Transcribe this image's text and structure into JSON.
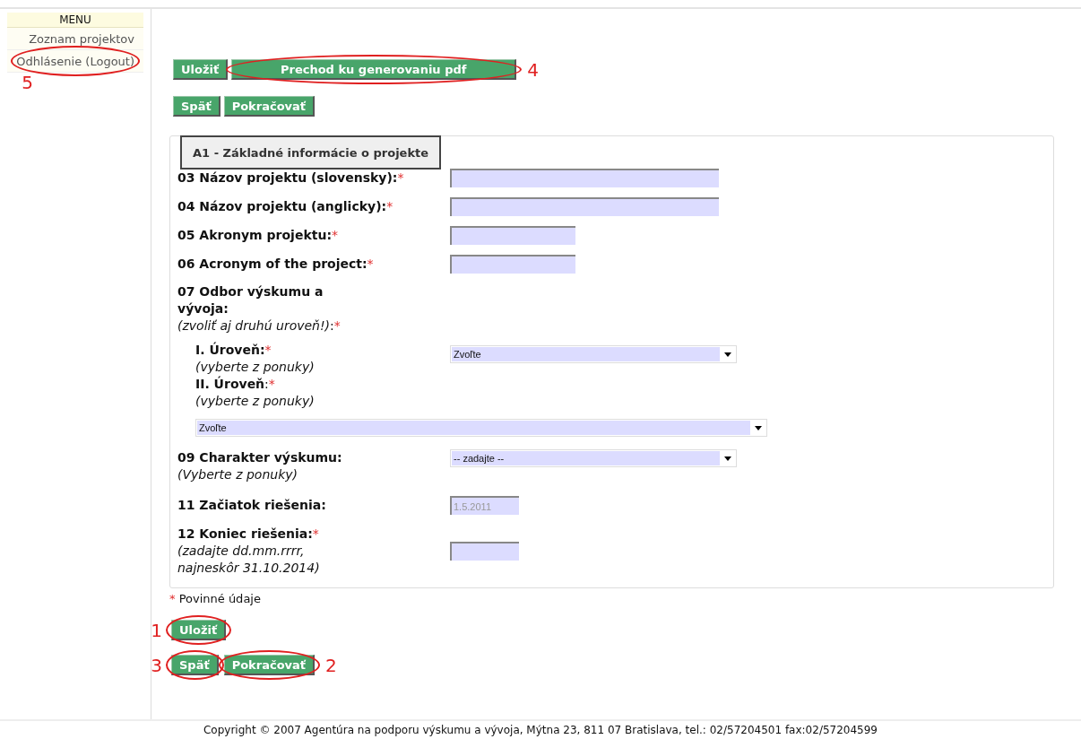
{
  "sidebar": {
    "title": "MENU",
    "items": [
      {
        "label": "Zoznam projektov"
      },
      {
        "label": "Odhlásenie (Logout)",
        "marker": "5"
      }
    ]
  },
  "top_actions": [
    {
      "label": "Uložiť"
    },
    {
      "label": "Prechod ku generovaniu pdf",
      "marker": "4"
    }
  ],
  "top_nav": [
    {
      "label": "Späť"
    },
    {
      "label": "Pokračovať"
    }
  ],
  "form": {
    "legend": "A1 - Základné informácie o projekte",
    "required_mark": "*",
    "fields": [
      {
        "kind": "long_text",
        "label": "03 Názov projektu (slovensky):",
        "required": true
      },
      {
        "kind": "long_text",
        "label": "04 Názov projektu (anglicky):",
        "required": true
      },
      {
        "kind": "short_text",
        "label": "05 Akronym projektu:",
        "required": true
      },
      {
        "kind": "short_text",
        "label": "06 Acronym of the project:",
        "required": true
      },
      {
        "kind": "group",
        "label": "07 Odbor výskumu a vývoja:",
        "hint": "*(zvoliť aj druhú uroveň!)*:",
        "required": true,
        "children": [
          {
            "kind": "inline_select",
            "label": "I. Úroveň:",
            "hint": "(vyberte z ponuky)",
            "required": true,
            "value": "Zvoľte"
          },
          {
            "kind": "wide_select",
            "label": "**II. Úroveň**:",
            "hint": "(vyberte z ponuky)",
            "required": true,
            "value": "Zvoľte"
          }
        ]
      },
      {
        "kind": "select",
        "label": "09 Charakter výskumu:",
        "hint": "(Vyberte z ponuky)",
        "required": false,
        "value": "-- zadajte --"
      },
      {
        "kind": "date",
        "label": "11 Začiatok riešenia:",
        "required": false,
        "value": "1.5.2011",
        "disabled": true
      },
      {
        "kind": "date",
        "label": "12 Koniec riešenia:",
        "hint": "(zadajte dd.mm.rrrr, najneskôr 31.10.2014)",
        "required": true,
        "disabled": false
      }
    ]
  },
  "required_note": "Povinné údaje",
  "bottom_save": {
    "label": "Uložiť",
    "marker": "1"
  },
  "bottom_nav": [
    {
      "label": "Späť",
      "marker": "3"
    },
    {
      "label": "Pokračovať",
      "marker": "2"
    }
  ],
  "footer": "Copyright © 2007 Agentúra na podporu výskumu a vývoja, Mýtna 23, 811 07 Bratislava, tel.: 02/57204501 fax:02/57204599"
}
